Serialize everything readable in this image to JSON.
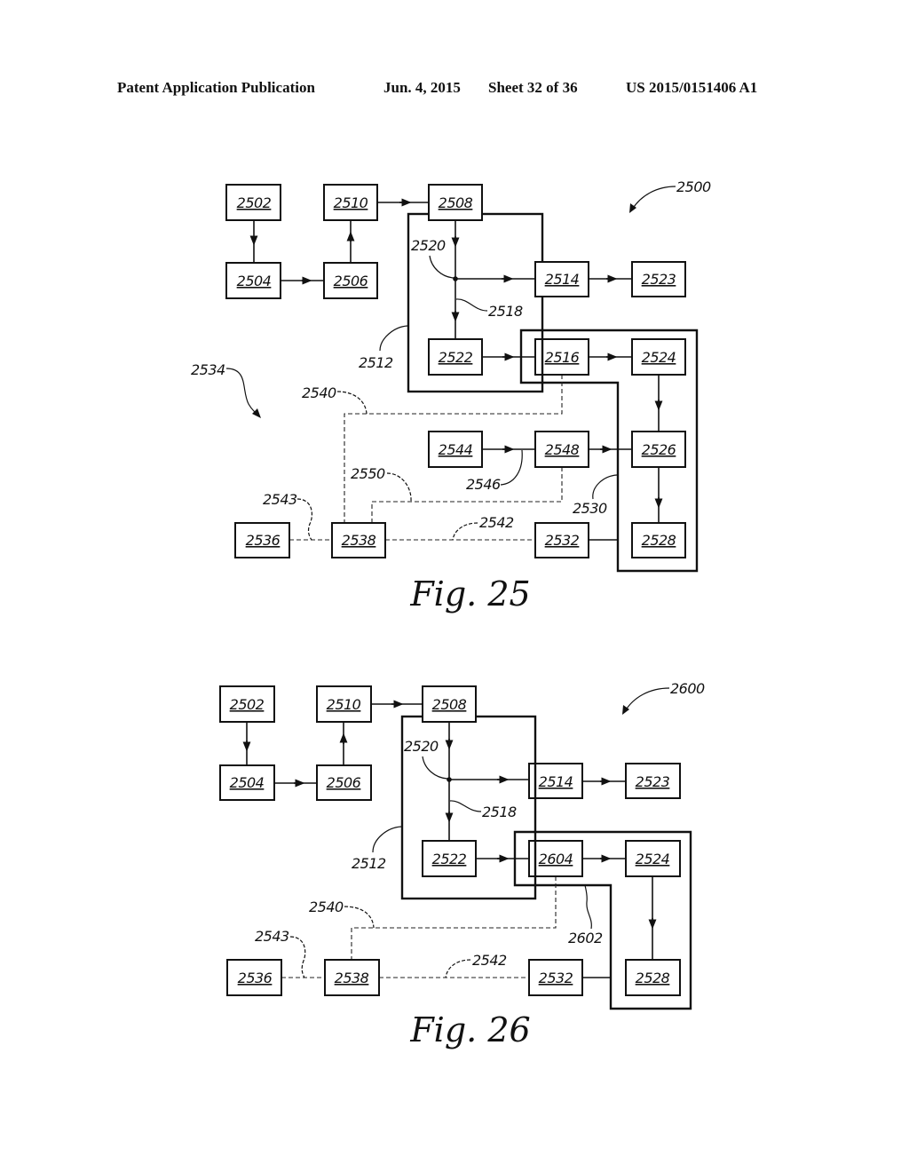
{
  "header": {
    "publication": "Patent Application Publication",
    "date": "Jun. 4, 2015",
    "sheet": "Sheet 32 of 36",
    "number": "US 2015/0151406 A1"
  },
  "figures": [
    {
      "caption": "Fig. 25",
      "ref": "2500",
      "boxes": [
        "2502",
        "2504",
        "2506",
        "2510",
        "2508",
        "2514",
        "2523",
        "2522",
        "2516",
        "2524",
        "2526",
        "2528",
        "2544",
        "2548",
        "2532",
        "2536",
        "2538"
      ],
      "outlines": [
        "2512",
        "2530"
      ],
      "refs": {
        "r2520": "2520",
        "r2518": "2518",
        "r2512": "2512",
        "r2534": "2534",
        "r2540": "2540",
        "r2550": "2550",
        "r2546": "2546",
        "r2530": "2530",
        "r2543": "2543",
        "r2542": "2542"
      }
    },
    {
      "caption": "Fig. 26",
      "ref": "2600",
      "boxes": [
        "2502",
        "2504",
        "2506",
        "2510",
        "2508",
        "2514",
        "2523",
        "2522",
        "2604",
        "2524",
        "2528",
        "2532",
        "2536",
        "2538"
      ],
      "outlines": [
        "2512",
        "2602"
      ],
      "refs": {
        "r2520": "2520",
        "r2518": "2518",
        "r2512": "2512",
        "r2540": "2540",
        "r2602": "2602",
        "r2543": "2543",
        "r2542": "2542"
      }
    }
  ]
}
